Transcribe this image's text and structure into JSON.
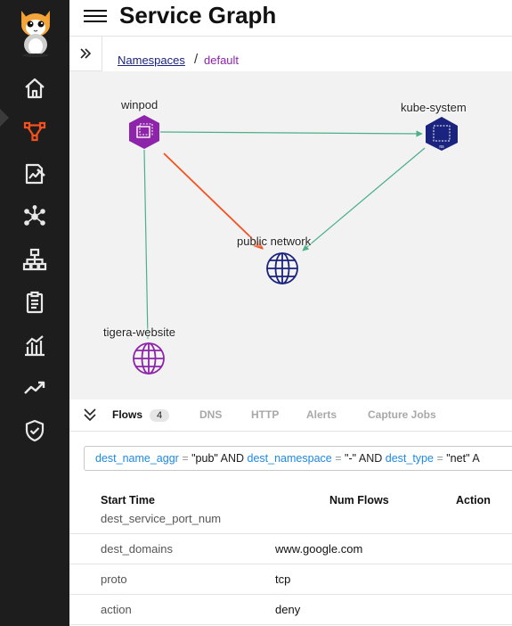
{
  "header": {
    "title": "Service Graph"
  },
  "breadcrumb": {
    "root": "Namespaces",
    "separator": "/",
    "current": "default"
  },
  "sidebar": {
    "items": [
      {
        "icon": "home-icon"
      },
      {
        "icon": "service-graph-icon",
        "active": true
      },
      {
        "icon": "policy-board-icon"
      },
      {
        "icon": "network-nodes-icon"
      },
      {
        "icon": "hierarchy-icon"
      },
      {
        "icon": "clipboard-icon"
      },
      {
        "icon": "bar-chart-icon"
      },
      {
        "icon": "trend-line-icon"
      },
      {
        "icon": "shield-check-icon"
      }
    ]
  },
  "graph": {
    "nodes": [
      {
        "id": "winpod",
        "label": "winpod",
        "icon": "pod-icon",
        "color": "#8e24aa"
      },
      {
        "id": "kube-system",
        "label": "kube-system",
        "icon": "namespace-icon",
        "badge": "ns",
        "color": "#1a237e"
      },
      {
        "id": "public-network",
        "label": "public network",
        "icon": "globe-icon",
        "color": "#1a237e"
      },
      {
        "id": "tigera-website",
        "label": "tigera-website",
        "icon": "globe-icon",
        "color": "#8e24aa"
      }
    ],
    "edges": [
      {
        "from": "winpod",
        "to": "kube-system",
        "color": "#4caf8a"
      },
      {
        "from": "winpod",
        "to": "public-network",
        "color": "#f4511e"
      },
      {
        "from": "kube-system",
        "to": "public-network",
        "color": "#4caf8a"
      },
      {
        "from": "winpod",
        "to": "tigera-website",
        "color": "#4caf8a"
      }
    ]
  },
  "tabs": [
    {
      "label": "Flows",
      "count": "4",
      "active": true
    },
    {
      "label": "DNS"
    },
    {
      "label": "HTTP"
    },
    {
      "label": "Alerts"
    },
    {
      "label": "Capture Jobs"
    }
  ],
  "filter": {
    "f1": "dest_name_aggr",
    "op1": "=",
    "v1": "\"pub\"",
    "and1": "AND",
    "f2": "dest_namespace",
    "op2": "=",
    "v2": "\"-\"",
    "and2": "AND",
    "f3": "dest_type",
    "op3": "=",
    "v3": "\"net\"",
    "and3": "A"
  },
  "table": {
    "columns": [
      "Start Time",
      "Num Flows",
      "Action"
    ],
    "partial_row_key": "dest_service_port_num",
    "rows": [
      {
        "key": "dest_domains",
        "value": "www.google.com"
      },
      {
        "key": "proto",
        "value": "tcp"
      },
      {
        "key": "action",
        "value": "deny"
      }
    ]
  }
}
